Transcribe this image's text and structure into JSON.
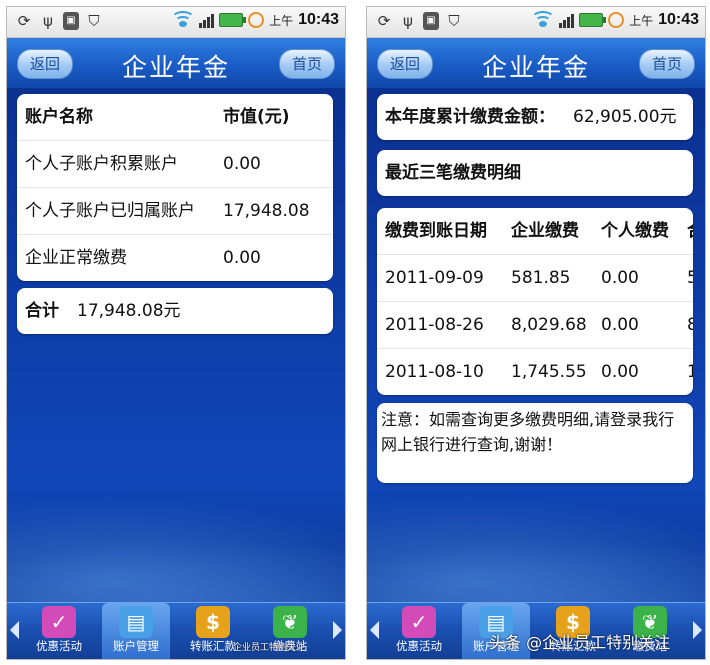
{
  "status": {
    "ampm": "上午",
    "time": "10:43"
  },
  "header": {
    "title": "企业年金",
    "back_label": "返回",
    "home_label": "首页"
  },
  "left": {
    "accounts": {
      "col_name": "账户名称",
      "col_value": "市值(元)",
      "rows": [
        {
          "name": "个人子账户积累账户",
          "value": "0.00"
        },
        {
          "name": "个人子账户已归属账户",
          "value": "17,948.08"
        },
        {
          "name": "企业正常缴费",
          "value": "0.00"
        }
      ]
    },
    "total": {
      "label": "合计",
      "value": "17,948.08元"
    },
    "watermark": "企业员工特别关注"
  },
  "right": {
    "annual": {
      "label": "本年度累计缴费金额：",
      "value": "62,905.00元"
    },
    "recent_title": "最近三笔缴费明细",
    "payments": {
      "col_date": "缴费到账日期",
      "col_company": "企业缴费",
      "col_personal": "个人缴费",
      "col_total_partial": "合",
      "rows": [
        {
          "date": "2011-09-09",
          "company": "581.85",
          "personal": "0.00",
          "total_partial": "5"
        },
        {
          "date": "2011-08-26",
          "company": "8,029.68",
          "personal": "0.00",
          "total_partial": "8"
        },
        {
          "date": "2011-08-10",
          "company": "1,745.55",
          "personal": "0.00",
          "total_partial": "1"
        }
      ]
    },
    "notice": "注意：如需查询更多缴费明细,请登录我行网上银行进行查询,谢谢！",
    "watermark": "头条 @企业员工特别关注"
  },
  "bottom_nav": [
    {
      "label": "优惠活动",
      "icon": "check-icon",
      "color": "#d24bb8"
    },
    {
      "label": "账户管理",
      "icon": "document-icon",
      "color": "#4aa0e6"
    },
    {
      "label": "转账汇款",
      "icon": "dollar-icon",
      "color": "#e6a21a"
    },
    {
      "label": "缴费站",
      "icon": "leaf-icon",
      "color": "#3cb34a"
    }
  ]
}
